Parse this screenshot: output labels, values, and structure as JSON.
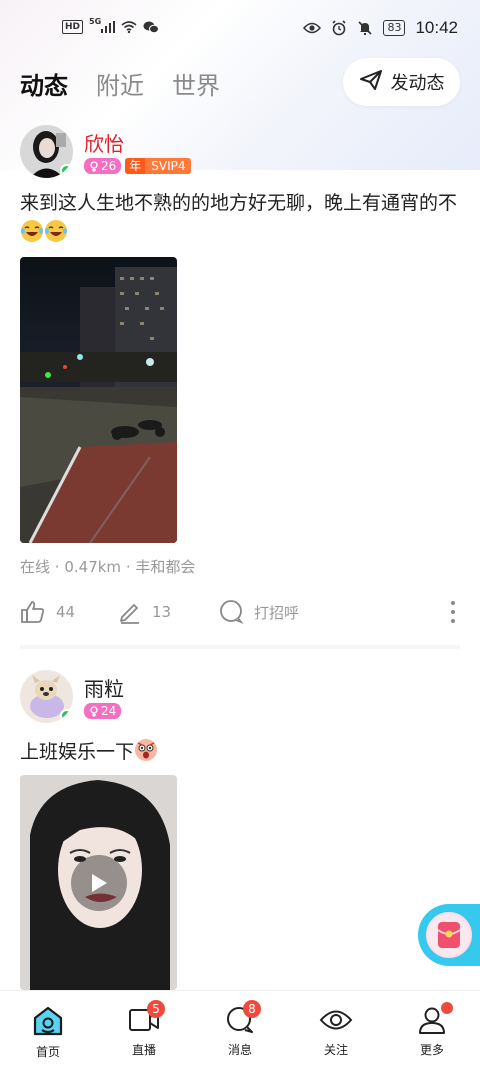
{
  "status_bar": {
    "time": "10:42",
    "battery": "83",
    "network": "5G",
    "hd": "HD"
  },
  "header": {
    "tabs": [
      {
        "label": "动态",
        "active": true
      },
      {
        "label": "附近",
        "active": false
      },
      {
        "label": "世界",
        "active": false
      }
    ],
    "post_button_label": "发动态"
  },
  "posts": [
    {
      "username": "欣怡",
      "username_color": "#e0212b",
      "online": true,
      "age": "26",
      "vip_prefix": "年",
      "vip": "SVIP4",
      "text": "来到这人生地不熟的的地方好无聊，晚上有通宵的不",
      "emojis": [
        "laughing-crying-emoji",
        "laughing-crying-emoji"
      ],
      "media": "night-street-photo",
      "status": "在线",
      "distance": "0.47km",
      "location": "丰和都会",
      "likes": "44",
      "comments": "13",
      "greet_label": "打招呼"
    },
    {
      "username": "雨粒",
      "username_color": "#222222",
      "online": true,
      "age": "24",
      "text": "上班娱乐一下",
      "emojis": [
        "shocked-emoji"
      ],
      "media": "video-thumbnail"
    }
  ],
  "bottom_nav": [
    {
      "label": "首页",
      "icon": "home-icon",
      "active": true
    },
    {
      "label": "直播",
      "icon": "live-video-icon",
      "badge": "5"
    },
    {
      "label": "消息",
      "icon": "message-icon",
      "badge": "8"
    },
    {
      "label": "关注",
      "icon": "eye-icon"
    },
    {
      "label": "更多",
      "icon": "profile-icon",
      "dot": true
    }
  ],
  "colors": {
    "accent_teal": "#36c9ee",
    "gender_badge": "#f46fc2",
    "vip_badge": "#ff7a3a",
    "online": "#2bc45a",
    "notification": "#f04a3e"
  }
}
